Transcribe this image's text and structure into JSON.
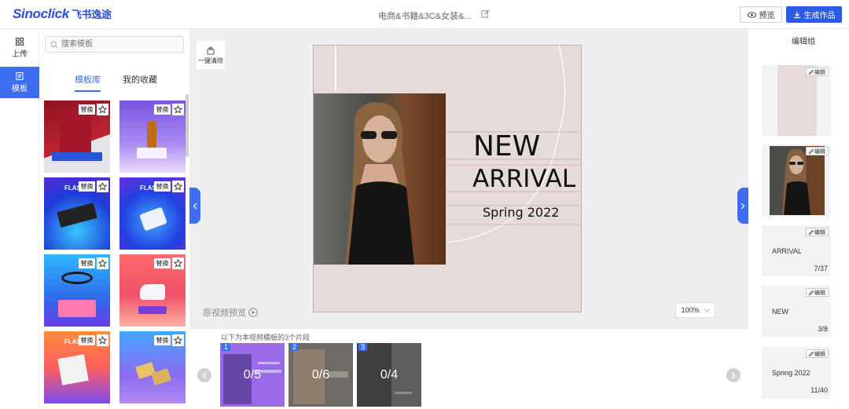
{
  "header": {
    "logo_text": "Sinoclick",
    "logo_cn": "飞书逸途",
    "doc_title": "电商&书籍&3C&女装&...",
    "preview_label": "预览",
    "generate_label": "生成作品"
  },
  "rail": {
    "upload_label": "上传",
    "templates_label": "模板"
  },
  "template_panel": {
    "search_placeholder": "搜索模板",
    "tabs": [
      "模板库",
      "我的收藏"
    ],
    "replace_label": "替换",
    "thumb_texts": [
      "",
      "",
      "FLASH",
      "FLASH",
      "",
      "FLASH",
      "FLASH",
      ""
    ]
  },
  "canvas": {
    "clear_label": "一键清除",
    "headline_new": "NEW",
    "headline_arrival": "ARRIVAL",
    "headline_spring": "Spring 2022",
    "video_preview_label": "原视频预览",
    "zoom": "100%"
  },
  "timeline": {
    "caption": "以下为本视频模板的3个片段",
    "clips": [
      {
        "num": "1",
        "count": "0/5"
      },
      {
        "num": "2",
        "count": "0/6"
      },
      {
        "num": "3",
        "count": "0/4"
      }
    ]
  },
  "right_panel": {
    "title": "编辑组",
    "edit_label": "编辑",
    "layers": [
      {
        "label": "",
        "count": ""
      },
      {
        "label": "",
        "count": ""
      },
      {
        "label": "ARRIVAL",
        "count": "7/37"
      },
      {
        "label": "NEW",
        "count": "3/8"
      },
      {
        "label": "Spring 2022",
        "count": "11/40"
      }
    ]
  },
  "colors": {
    "brand": "#2c5be6",
    "accent": "#3d6ef0",
    "artboard_bg": "#e5dcda"
  }
}
